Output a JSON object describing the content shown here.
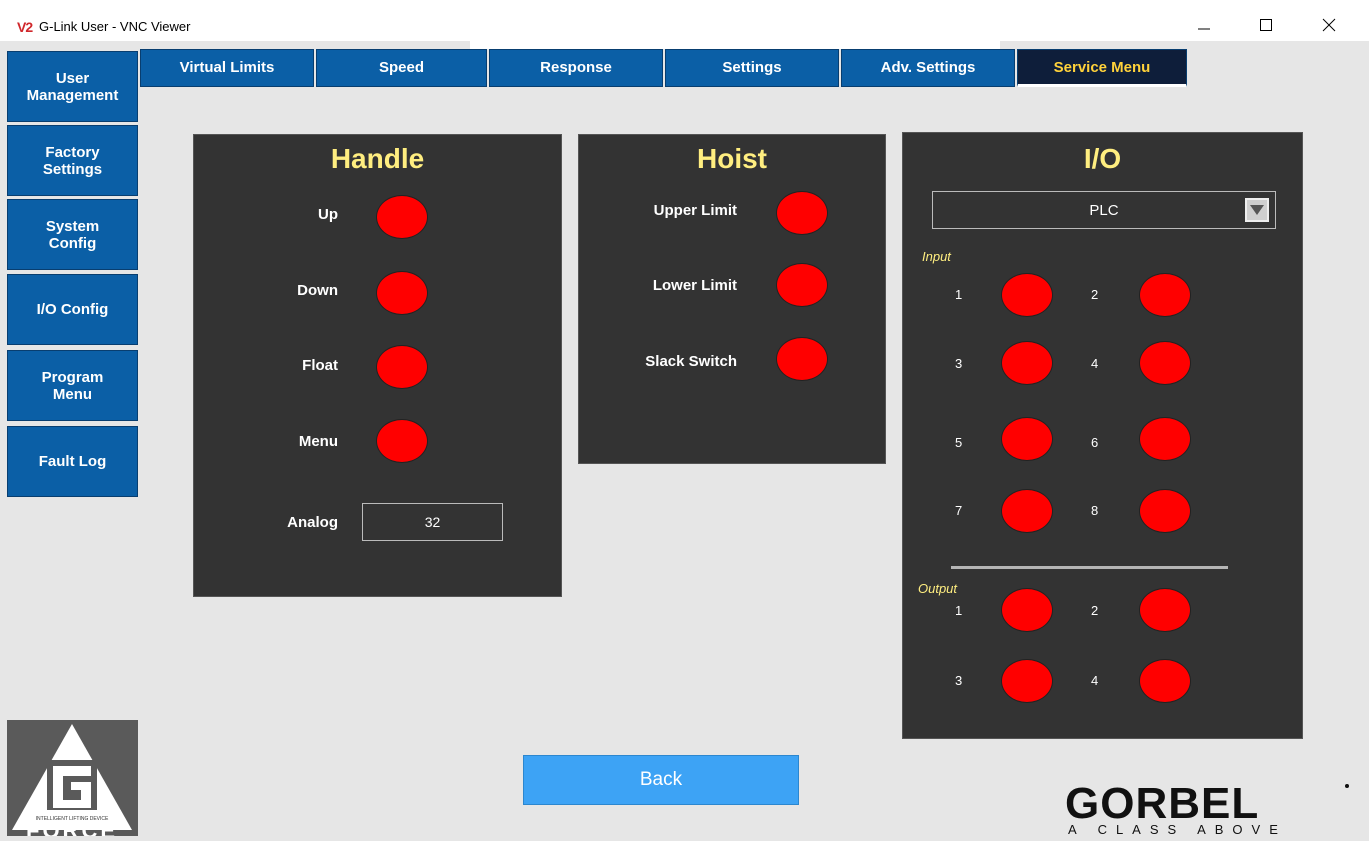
{
  "window": {
    "logo_text": "V2",
    "title": "G-Link User - VNC Viewer"
  },
  "sidebar": {
    "items": [
      {
        "label": "User\nManagement"
      },
      {
        "label": "Factory\nSettings"
      },
      {
        "label": "System\nConfig"
      },
      {
        "label": "I/O Config"
      },
      {
        "label": "Program\nMenu"
      },
      {
        "label": "Fault Log"
      }
    ]
  },
  "tabs": [
    {
      "label": "Virtual Limits"
    },
    {
      "label": "Speed"
    },
    {
      "label": "Response"
    },
    {
      "label": "Settings"
    },
    {
      "label": "Adv. Settings"
    },
    {
      "label": "Service Menu",
      "active": true
    }
  ],
  "handle": {
    "title": "Handle",
    "rows": [
      {
        "label": "Up",
        "state": "off"
      },
      {
        "label": "Down",
        "state": "off"
      },
      {
        "label": "Float",
        "state": "off"
      },
      {
        "label": "Menu",
        "state": "off"
      }
    ],
    "analog_label": "Analog",
    "analog_value": "32"
  },
  "hoist": {
    "title": "Hoist",
    "rows": [
      {
        "label": "Upper Limit",
        "state": "off"
      },
      {
        "label": "Lower Limit",
        "state": "off"
      },
      {
        "label": "Slack Switch",
        "state": "off"
      }
    ]
  },
  "io": {
    "title": "I/O",
    "source_select": "PLC",
    "input_label": "Input",
    "inputs": [
      "1",
      "2",
      "3",
      "4",
      "5",
      "6",
      "7",
      "8"
    ],
    "output_label": "Output",
    "outputs": [
      "1",
      "2",
      "3",
      "4"
    ]
  },
  "back_label": "Back",
  "colors": {
    "led_off": "#ff0000",
    "tab_blue": "#0b5fa6",
    "panel_bg": "#333333",
    "title_yellow": "#ffee80",
    "back_blue": "#3da3f5"
  },
  "branding": {
    "gforce": "FORCE",
    "gforce_tagline": "INTELLIGENT LIFTING DEVICE",
    "gorbel": "GORBEL",
    "gorbel_tagline": "A  CLASS  ABOVE"
  }
}
